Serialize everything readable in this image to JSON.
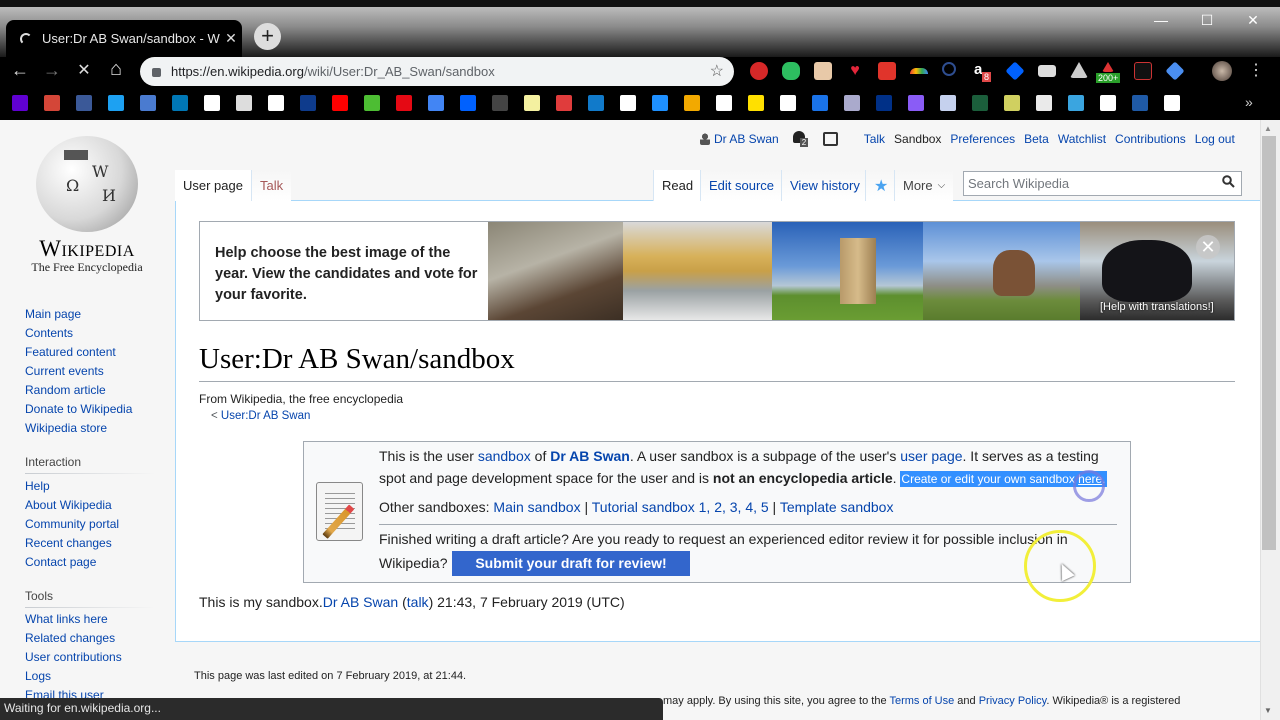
{
  "browser": {
    "tab_title": "User:Dr AB Swan/sandbox - Wikipedia",
    "tab_title_visible": "User:Dr AB Swan/sandbox - Wiki",
    "new_tab": "+",
    "url_host": "https://en.wikipedia.org",
    "url_path": "/wiki/User:Dr_AB_Swan/sandbox",
    "window_controls": {
      "minimize": "—",
      "maximize": "☐",
      "close": "✕"
    },
    "nav": {
      "back": "←",
      "forward": "→",
      "stop": "✕",
      "home": "⌂"
    },
    "extensions": [
      "adblock",
      "evernote",
      "toolbox",
      "heart",
      "magic-wand",
      "rainbow",
      "search-zoom",
      "amazon",
      "dropbox",
      "dark-box",
      "google-drive",
      "alert",
      "pdf",
      "blue-diamond"
    ],
    "extension_badges": {
      "amazon": "8",
      "alert": "200+"
    },
    "bookmarks": [
      "Yahoo",
      "Gmail",
      "Facebook",
      "Twitter",
      "Brain",
      "LinkedIn",
      "A",
      "H",
      "Wikipedia",
      "The Weather Channel",
      "YouTube",
      "Houzz",
      "Netflix",
      "Google",
      "Dropbox",
      "Dots",
      "P",
      "Q",
      "Chase",
      "Citi",
      "Blue",
      "Charts",
      "Doc",
      "Best Buy",
      "Verizon",
      "G",
      "Liberty",
      "PayPal",
      "Asterisk",
      "Honda",
      "C",
      "n",
      "Fan",
      "Star",
      "X",
      "ADT",
      "Doc"
    ],
    "bookmarks_more": "»",
    "status_text": "Waiting for en.wikipedia.org..."
  },
  "wiki": {
    "logo_wordmark": "Wikipedia",
    "logo_tagline": "The Free Encyclopedia",
    "sidebar": {
      "navigation": [
        "Main page",
        "Contents",
        "Featured content",
        "Current events",
        "Random article",
        "Donate to Wikipedia",
        "Wikipedia store"
      ],
      "interaction_heading": "Interaction",
      "interaction": [
        "Help",
        "About Wikipedia",
        "Community portal",
        "Recent changes",
        "Contact page"
      ],
      "tools_heading": "Tools",
      "tools": [
        "What links here",
        "Related changes",
        "User contributions",
        "Logs",
        "Email this user"
      ]
    },
    "personal": {
      "username": "Dr AB Swan",
      "notification_count": "2",
      "links": [
        "Talk",
        "Sandbox",
        "Preferences",
        "Beta",
        "Watchlist",
        "Contributions",
        "Log out"
      ]
    },
    "tabs": {
      "left": [
        "User page",
        "Talk"
      ],
      "right": [
        "Read",
        "Edit source",
        "View history"
      ],
      "more": "More",
      "search_placeholder": "Search Wikipedia"
    },
    "banner": {
      "text": "Help choose the best image of the year. View the candidates and vote for your favorite.",
      "translate": "[Help with translations!]",
      "close": "✕"
    },
    "title": "User:Dr AB Swan/sandbox",
    "site_sub": "From Wikipedia, the free encyclopedia",
    "content_sub_prefix": "< ",
    "content_sub_link": "User:Dr AB Swan",
    "notice": {
      "l1_a": "This is the user ",
      "l1_link1": "sandbox",
      "l1_b": " of ",
      "l1_user": "Dr AB Swan",
      "l1_c": ". A user sandbox is a subpage of the user's ",
      "l1_link2": "user page",
      "l1_d": ". It serves as a testing",
      "l2_a": "spot and page development space for the user and is ",
      "l2_bold": "not an encyclopedia article",
      "l2_b": ". ",
      "l2_highlight": "Create or edit your own sandbox ",
      "l2_here": "here",
      "l2_end": ".",
      "l3_a": "Other sandboxes: ",
      "l3_main": "Main sandbox",
      "l3_sep1": " | ",
      "l3_tutorial": "Tutorial sandbox 1, 2, 3, 4, 5",
      "l3_sep2": " | ",
      "l3_template": "Template sandbox",
      "l4": "Finished writing a draft article? Are you ready to request an experienced editor review it for possible inclusion in",
      "l5": "Wikipedia?",
      "submit": "Submit your draft for review!"
    },
    "sandbox_text": "This is my sandbox.",
    "sig_user": "Dr AB Swan",
    "sig_talk": "talk",
    "sig_time": " 21:43, 7 February 2019 (UTC)",
    "footer": {
      "last_edited": "This page was last edited on 7 February 2019, at 21:44.",
      "terms_a": "may apply. By using this site, you agree to the ",
      "terms_link": "Terms of Use",
      "terms_b": " and ",
      "privacy_link": "Privacy Policy",
      "terms_c": ". Wikipedia® is a registered"
    }
  }
}
